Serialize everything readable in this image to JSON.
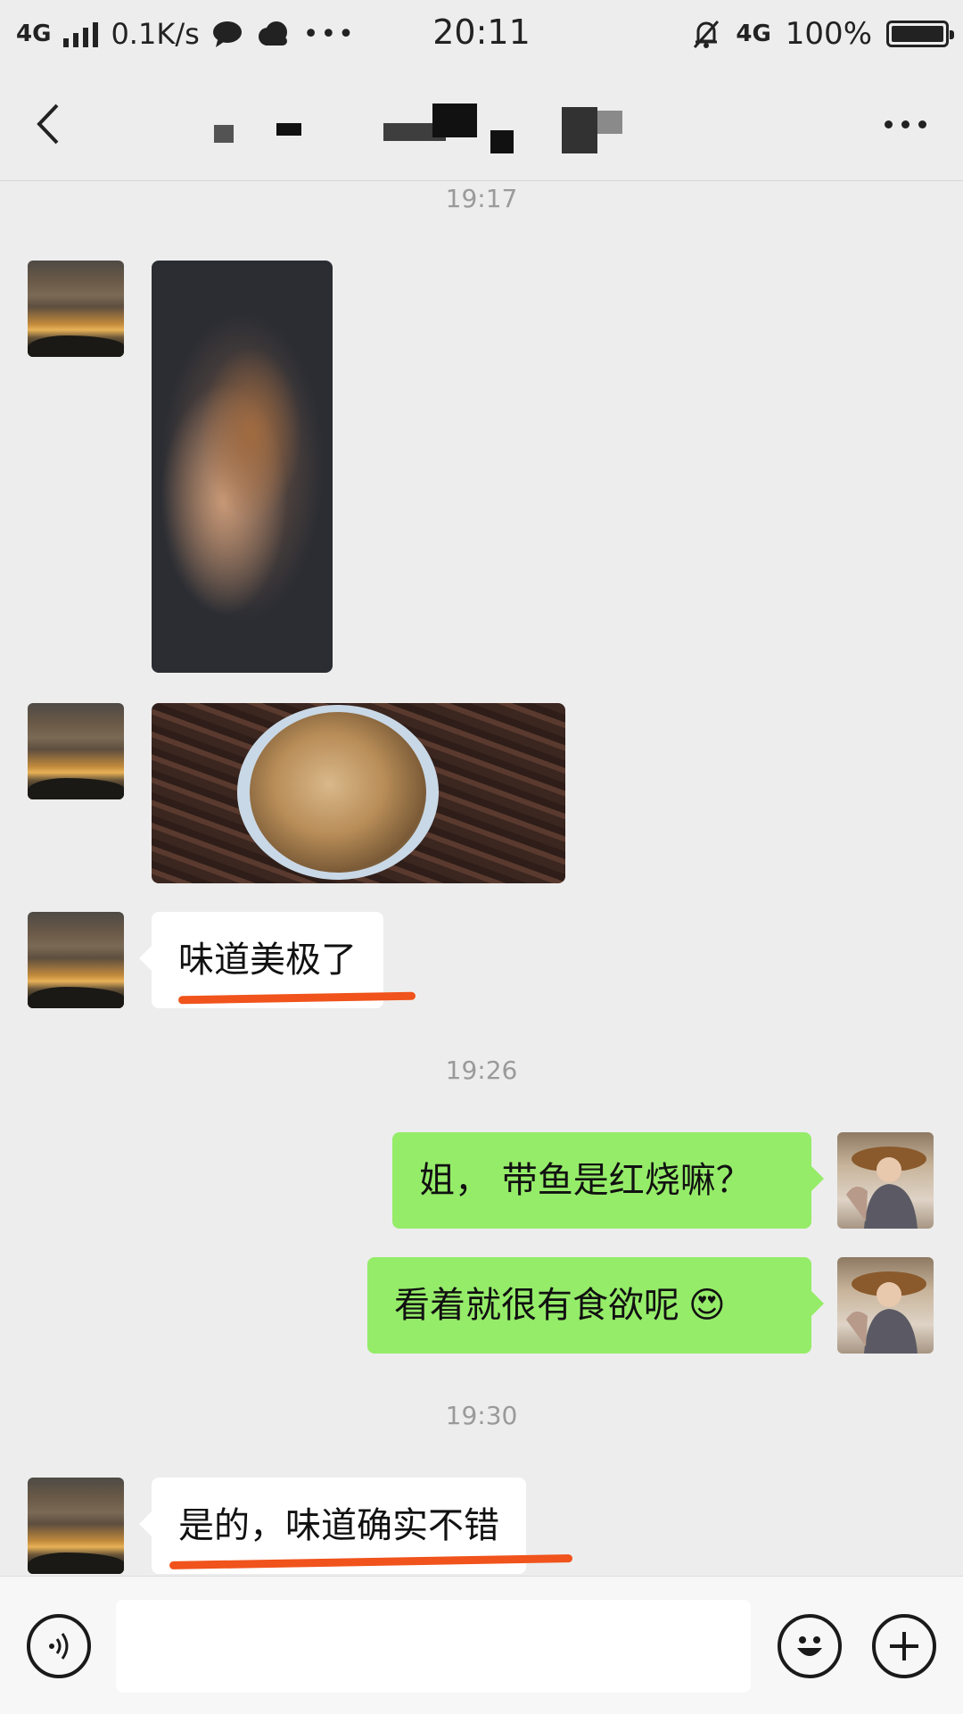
{
  "status_bar": {
    "network": "4G",
    "speed": "0.1K/s",
    "time": "20:11",
    "network_right": "4G",
    "battery": "100%"
  },
  "nav": {
    "back_icon": "chevron-left-icon",
    "more_icon": "ellipsis-icon"
  },
  "messages": [
    {
      "type": "timestamp",
      "text": "19:17"
    },
    {
      "type": "image",
      "side": "left",
      "avatar": "sunset-avatar",
      "desc": "pan-photo"
    },
    {
      "type": "image",
      "side": "left",
      "avatar": "sunset-avatar",
      "desc": "bowl-photo"
    },
    {
      "type": "text",
      "side": "left",
      "text": "味道美极了",
      "highlight": true
    },
    {
      "type": "timestamp",
      "text": "19:26"
    },
    {
      "type": "text",
      "side": "right",
      "text": "姐， 带鱼是红烧嘛？"
    },
    {
      "type": "text",
      "side": "right",
      "text": "看着就很有食欲呢",
      "emoji": "😍"
    },
    {
      "type": "timestamp",
      "text": "19:30"
    },
    {
      "type": "text",
      "side": "left",
      "text": "是的，味道确实不错",
      "highlight": true
    }
  ],
  "colors": {
    "background": "#ededed",
    "green_bubble": "#95ec69",
    "white_bubble": "#ffffff",
    "highlight_underline": "#f0531b"
  },
  "input_bar": {
    "voice_icon": "voice-icon",
    "emoji_icon": "emoji-icon",
    "plus_icon": "plus-icon",
    "input_value": ""
  }
}
